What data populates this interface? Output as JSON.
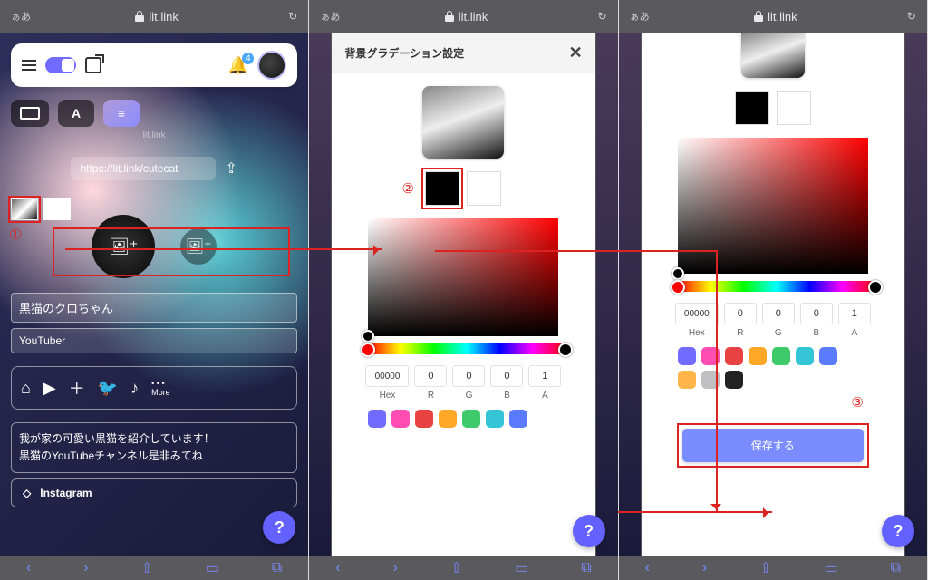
{
  "browser": {
    "aa": "ぁあ",
    "domain": "lit.link",
    "reload": "↻"
  },
  "annotations": {
    "step1": "①",
    "step2": "②",
    "step3": "③"
  },
  "pane1": {
    "bell_count": "4",
    "watermark": "lit.link",
    "url_value": "https://lit.link/cutecat",
    "name": "黒猫のクロちゃん",
    "role": "YouTuber",
    "more": "More",
    "desc_l1": "我が家の可愛い黒猫を紹介しています！",
    "desc_l2": "黒猫のYouTubeチャンネル是非みてね",
    "ig_label": "Instagram",
    "mode_a": "A"
  },
  "modal": {
    "title": "背景グラデーション設定",
    "hex_label": "Hex",
    "labels": [
      "R",
      "G",
      "B",
      "A"
    ],
    "hex": "00000",
    "r": "0",
    "g": "0",
    "b": "0",
    "a": "1",
    "save": "保存する"
  },
  "presets_p2": [
    "#726bff",
    "#ff4db2",
    "#e84242",
    "#ffa726",
    "#3ec96b",
    "#34c6d6",
    "#5a7aff"
  ],
  "presets_p3_row1": [
    "#726bff",
    "#ff4db2",
    "#e84242",
    "#ffa726",
    "#3ec96b",
    "#34c6d6",
    "#5a7aff"
  ],
  "presets_p3_row2": [
    "#ffb54a",
    "#c0c0c2",
    "#222222"
  ],
  "help": "?"
}
